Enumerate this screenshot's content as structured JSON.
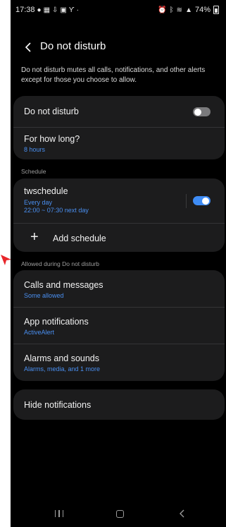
{
  "status_bar": {
    "time": "17:38",
    "left_icons": [
      "chat-bubble-icon",
      "gallery-icon",
      "download-icon",
      "image-icon",
      "signal-tower-icon",
      "dot-icon"
    ],
    "right_icons": [
      "alarm-icon",
      "bluetooth-icon",
      "wifi-icon",
      "signal-icon"
    ],
    "battery": "74%"
  },
  "header": {
    "back_icon": "chevron-left-icon",
    "title": "Do not disturb"
  },
  "description": "Do not disturb mutes all calls, notifications, and other alerts except for those you choose to allow.",
  "main_card": {
    "dnd_label": "Do not disturb",
    "dnd_enabled": false,
    "for_how_long_label": "For how long?",
    "for_how_long_value": "8 hours"
  },
  "schedule": {
    "section_label": "Schedule",
    "items": [
      {
        "name": "twschedule",
        "days": "Every day",
        "time": "22:00 ~ 07:30 next day",
        "enabled": true
      }
    ],
    "add_label": "Add schedule"
  },
  "allowed": {
    "section_label": "Allowed during Do not disturb",
    "items": [
      {
        "label": "Calls and messages",
        "sub": "Some allowed"
      },
      {
        "label": "App notifications",
        "sub": "ActiveAlert"
      },
      {
        "label": "Alarms and sounds",
        "sub": "Alarms, media, and 1 more"
      }
    ]
  },
  "hide_notifications": {
    "label": "Hide notifications"
  },
  "nav_bar": {
    "buttons": [
      "recents-icon",
      "home-icon",
      "back-icon"
    ]
  },
  "colors": {
    "accent": "#3e8cf5",
    "subtext": "#4a8ff0",
    "card": "#1c1c1d",
    "background": "#000000",
    "annotation_arrow": "#e8262a"
  }
}
